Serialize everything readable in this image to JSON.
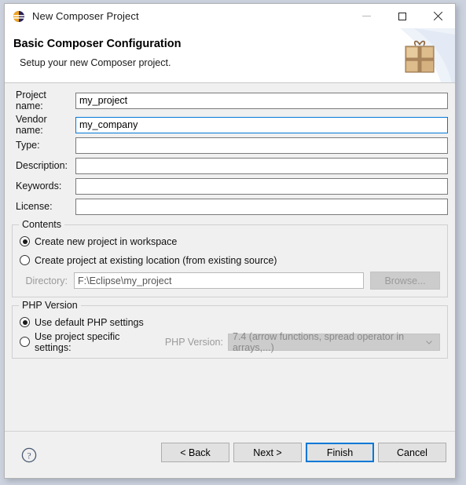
{
  "window": {
    "title": "New Composer Project",
    "app_icon": "eclipse-icon",
    "controls": {
      "minimize": "minimize-icon",
      "maximize": "maximize-icon",
      "close": "close-icon"
    }
  },
  "banner": {
    "title": "Basic Composer Configuration",
    "subtitle": "Setup your new Composer project.",
    "art": "gift-box-icon"
  },
  "form": {
    "fields": [
      {
        "label": "Project name:",
        "value": "my_project",
        "focused": false
      },
      {
        "label": "Vendor name:",
        "value": "my_company",
        "focused": true
      },
      {
        "label": "Type:",
        "value": "",
        "focused": false
      },
      {
        "label": "Description:",
        "value": "",
        "focused": false
      },
      {
        "label": "Keywords:",
        "value": "",
        "focused": false
      },
      {
        "label": "License:",
        "value": "",
        "focused": false
      }
    ]
  },
  "contents_group": {
    "title": "Contents",
    "options": [
      {
        "label": "Create new project in workspace",
        "checked": true
      },
      {
        "label": "Create project at existing location (from existing source)",
        "checked": false
      }
    ],
    "directory": {
      "label": "Directory:",
      "value": "F:\\Eclipse\\my_project",
      "browse_label": "Browse...",
      "disabled": true
    }
  },
  "php_group": {
    "title": "PHP Version",
    "options": [
      {
        "label": "Use default PHP settings",
        "checked": true
      },
      {
        "label": "Use project specific settings:",
        "checked": false
      }
    ],
    "version_label": "PHP Version:",
    "version_value": "7.4 (arrow functions, spread operator in arrays,...)",
    "disabled": true
  },
  "footer": {
    "help_icon": "help-question-icon",
    "buttons": [
      {
        "label": "< Back",
        "primary": false
      },
      {
        "label": "Next >",
        "primary": false
      },
      {
        "label": "Finish",
        "primary": true
      },
      {
        "label": "Cancel",
        "primary": false
      }
    ]
  },
  "colors": {
    "accent": "#0078d7",
    "dialog_bg": "#f0f0f0",
    "banner_bg": "#ffffff"
  }
}
